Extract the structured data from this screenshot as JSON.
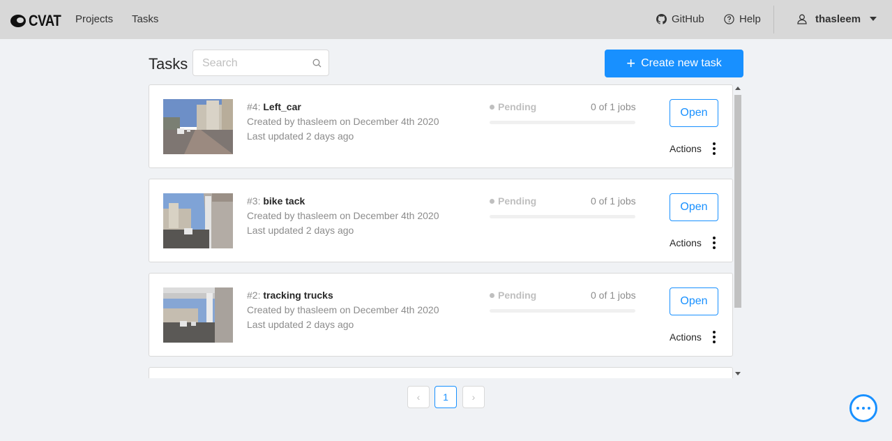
{
  "header": {
    "logo_text": "CVAT",
    "nav": [
      "Projects",
      "Tasks"
    ],
    "github_label": "GitHub",
    "help_label": "Help",
    "username": "thasleem"
  },
  "page": {
    "title": "Tasks",
    "search_placeholder": "Search",
    "create_label": "Create new task"
  },
  "tasks": [
    {
      "id": "#4:",
      "name": "Left_car",
      "created": "Created by thasleem on December 4th 2020",
      "updated": "Last updated 2 days ago",
      "status": "Pending",
      "jobs": "0 of 1 jobs",
      "progress": 0,
      "open_label": "Open",
      "actions_label": "Actions"
    },
    {
      "id": "#3:",
      "name": "bike tack",
      "created": "Created by thasleem on December 4th 2020",
      "updated": "Last updated 2 days ago",
      "status": "Pending",
      "jobs": "0 of 1 jobs",
      "progress": 0,
      "open_label": "Open",
      "actions_label": "Actions"
    },
    {
      "id": "#2:",
      "name": "tracking trucks",
      "created": "Created by thasleem on December 4th 2020",
      "updated": "Last updated 2 days ago",
      "status": "Pending",
      "jobs": "0 of 1 jobs",
      "progress": 0,
      "open_label": "Open",
      "actions_label": "Actions"
    }
  ],
  "pagination": {
    "prev": "‹",
    "current": "1",
    "next": "›"
  },
  "colors": {
    "accent": "#1890ff",
    "header_bg": "#d8d8d8",
    "page_bg": "#f0f2f5"
  },
  "icons": [
    "cvat-logo-icon",
    "github-icon",
    "help-icon",
    "user-icon",
    "caret-down-icon",
    "search-icon",
    "plus-icon",
    "more-vertical-icon",
    "chat-icon"
  ]
}
